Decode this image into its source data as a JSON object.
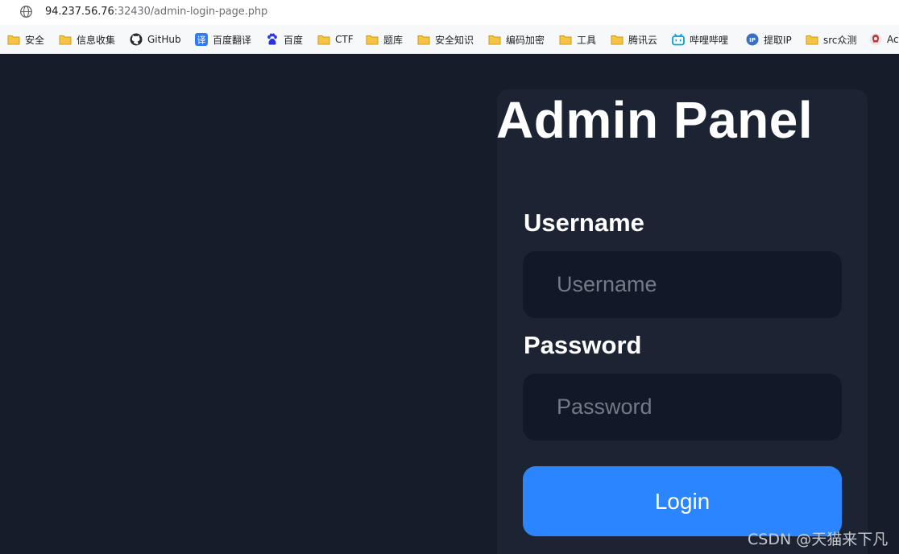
{
  "browser": {
    "url_host": "94.237.56.76",
    "url_path": ":32430/admin-login-page.php"
  },
  "bookmarks": [
    {
      "label": "安全",
      "icon": "folder-icon"
    },
    {
      "label": "信息收集",
      "icon": "folder-icon"
    },
    {
      "label": "GitHub",
      "icon": "github-icon"
    },
    {
      "label": "百度翻译",
      "icon": "translate-icon"
    },
    {
      "label": "百度",
      "icon": "baidu-paw-icon"
    },
    {
      "label": "CTF",
      "icon": "folder-icon"
    },
    {
      "label": "题库",
      "icon": "folder-icon"
    },
    {
      "label": "安全知识",
      "icon": "folder-icon"
    },
    {
      "label": "编码加密",
      "icon": "folder-icon"
    },
    {
      "label": "工具",
      "icon": "folder-icon"
    },
    {
      "label": "腾讯云",
      "icon": "folder-icon"
    },
    {
      "label": "哔哩哔哩",
      "icon": "bilibili-icon"
    },
    {
      "label": "提取IP",
      "icon": "ip-icon"
    },
    {
      "label": "src众测",
      "icon": "folder-icon"
    },
    {
      "label": "Ac",
      "icon": "app-icon"
    }
  ],
  "colors": {
    "page_background": "#161c29",
    "panel_background": "#1c2434",
    "input_background": "#111827",
    "button_blue": "#2b85fe",
    "folder_yellow": "#f6c544"
  },
  "login": {
    "title": "Admin Panel",
    "username_label": "Username",
    "username_placeholder": "Username",
    "username_value": "",
    "password_label": "Password",
    "password_placeholder": "Password",
    "password_value": "",
    "submit_label": "Login"
  },
  "watermark": "CSDN @天猫来下凡"
}
